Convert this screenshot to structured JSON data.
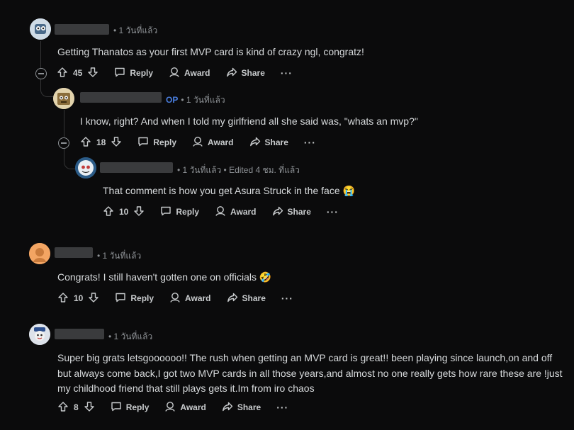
{
  "comments": [
    {
      "time": "• 1 วันที่แล้ว",
      "body": "Getting Thanatos as your first MVP card is kind of crazy ngl, congratz!",
      "score": "45"
    },
    {
      "op_badge": "OP",
      "time": "• 1 วันที่แล้ว",
      "body": "I know, right? And when I told my girlfriend all she said was, \"whats an mvp?\"",
      "score": "18"
    },
    {
      "time": "• 1 วันที่แล้ว • Edited 4 ชม. ที่แล้ว",
      "body": "That comment is how you get Asura Struck in the face 😭",
      "score": "10"
    },
    {
      "time": "• 1 วันที่แล้ว",
      "body": "Congrats! I still haven't gotten one on officials 🤣",
      "score": "10"
    },
    {
      "time": "• 1 วันที่แล้ว",
      "body_lines": [
        "Super big grats letsgoooooo!! The rush when getting an MVP card is great!! been playing since launch,on and off",
        "but always come back,I got two MVP cards in all those years,and almost no one really gets how rare these are !just",
        "my childhood friend that still plays gets it.Im from iro chaos"
      ],
      "score": "8"
    }
  ],
  "actions": {
    "reply": "Reply",
    "award": "Award",
    "share": "Share",
    "more": "···"
  }
}
